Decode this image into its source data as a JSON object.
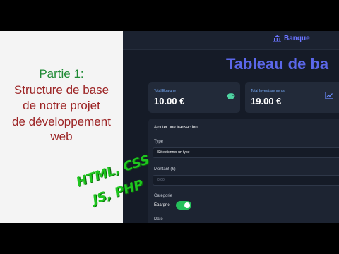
{
  "thumbnail": {
    "title_lines": [
      "Partie 1:",
      "Structure de base",
      "de notre projet",
      "de développement web"
    ],
    "tags": [
      "HTML, CSS",
      "JS, PHP"
    ]
  },
  "app": {
    "brand": "Banque",
    "brand_icon": "bank-icon",
    "page_title": "Tableau de ba",
    "cards": [
      {
        "label": "Total Epargne",
        "value": "10.00 €",
        "icon": "piggy-bank-icon"
      },
      {
        "label": "Total Investissements",
        "value": "19.00 €",
        "icon": "chart-line-icon"
      }
    ],
    "form": {
      "title": "Ajouter une transaction",
      "type_label": "Type",
      "type_selected": "Sélectionner un type",
      "amount_label": "Montant (€)",
      "amount_placeholder": "0.00",
      "category_label": "Catégorie",
      "toggle_label": "Epargne",
      "toggle_on": true,
      "date_label": "Date"
    },
    "colors": {
      "accent": "#5b67ea",
      "toggle": "#25c05b",
      "background": "#151b27",
      "card": "#222a39"
    }
  }
}
